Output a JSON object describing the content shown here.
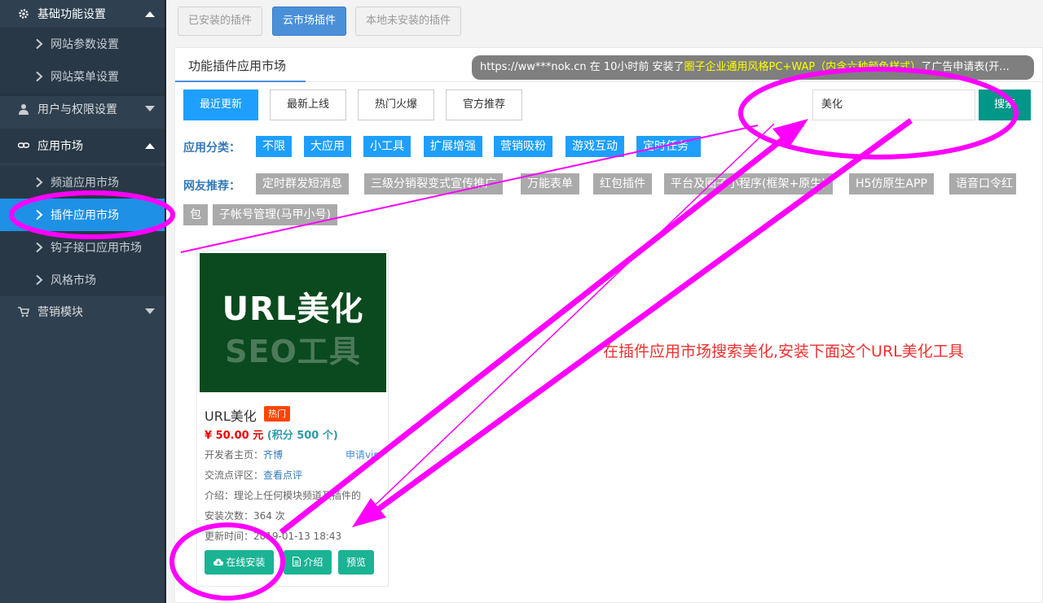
{
  "sidebar": {
    "group_basic": {
      "label": "基础功能设置"
    },
    "site_params": {
      "label": "网站参数设置"
    },
    "site_menu": {
      "label": "网站菜单设置"
    },
    "users": {
      "label": "用户与权限设置"
    },
    "app_market": {
      "label": "应用市场"
    },
    "channel_market": {
      "label": "频道应用市场"
    },
    "plugin_market": {
      "label": "插件应用市场"
    },
    "hook_market": {
      "label": "钩子接口应用市场"
    },
    "style_market": {
      "label": "风格市场"
    },
    "marketing": {
      "label": "营销模块"
    },
    "colors": {
      "bg": "#2f4050",
      "active": "#1e90e6"
    }
  },
  "top_tabs": [
    "已安装的插件",
    "云市场插件",
    "本地未安装的插件"
  ],
  "panel_tab": "功能插件应用市场",
  "sort_buttons": [
    "最近更新",
    "最新上线",
    "热门火爆",
    "官方推荐"
  ],
  "search": {
    "value": "美化",
    "button": "搜索"
  },
  "categories": {
    "label": "应用分类：",
    "items": [
      "不限",
      "大应用",
      "小工具",
      "扩展增强",
      "营销吸粉",
      "游戏互动",
      "定时任务"
    ]
  },
  "recommend": {
    "label": "网友推荐：",
    "items": [
      "定时群发短消息",
      "三级分销裂变式宣传推广",
      "万能表单",
      "红包插件",
      "平台及圈子小程序(框架+原生)",
      "H5仿原生APP",
      "语音口令红",
      "包",
      "子帐号管理(马甲小号)"
    ]
  },
  "card": {
    "image_line1": "URL美化",
    "image_line2": "SEO工具",
    "title": "URL美化",
    "badge": "热门",
    "price": "¥ 50.00 元",
    "points": "(积分 500 个)",
    "dev_label": "开发者主页：",
    "dev_name": "齐博",
    "vip": "申请vip",
    "comment_label": "交流点评区：",
    "comment_link": "查看点评",
    "intro": "介绍：理论上任何模块频道及插件的",
    "installs": "安装次数：364 次",
    "updated": "更新时间：2019-01-13 18:43",
    "btn_install": "在线安装",
    "btn_intro": "介绍",
    "btn_preview": "预览"
  },
  "notice": {
    "prefix": "https://ww***nok.cn 在 10小时前 安装了",
    "highlight": "圈子企业通用风格PC+WAP（内含六种颜色样式）",
    "suffix": "了广告申请表(开..."
  },
  "instruction": "在插件应用市场搜索美化,安装下面这个URL美化工具",
  "annotation_color": "#ff00ff"
}
